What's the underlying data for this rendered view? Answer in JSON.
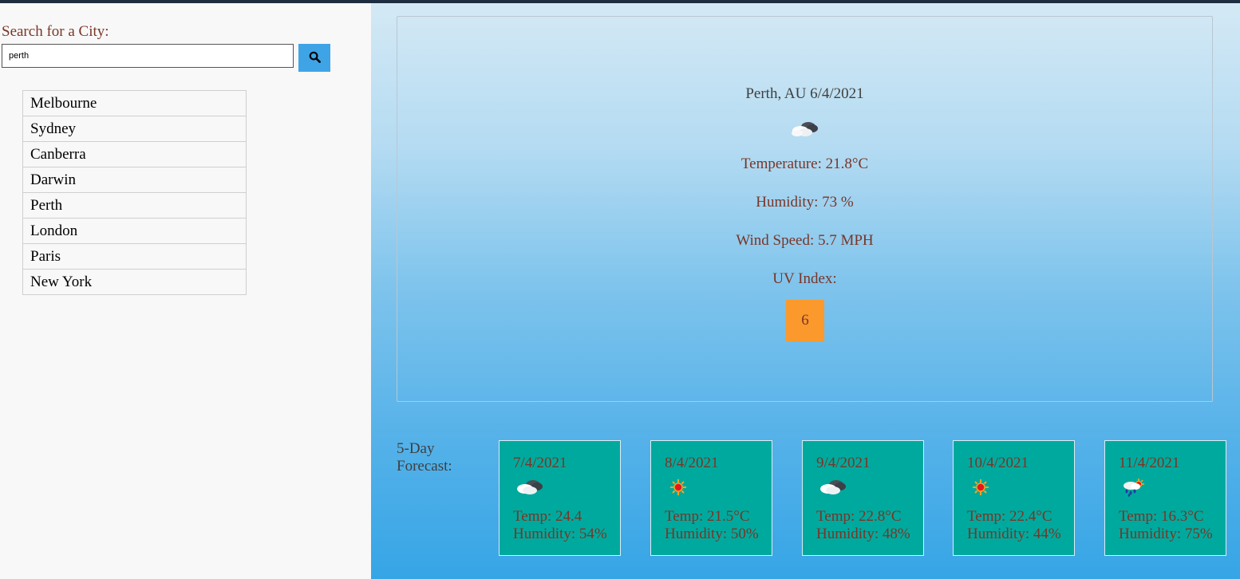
{
  "search": {
    "label": "Search for a City:",
    "value": "perth",
    "button_icon": "search-icon"
  },
  "history": [
    {
      "label": "Melbourne"
    },
    {
      "label": "Sydney"
    },
    {
      "label": "Canberra"
    },
    {
      "label": "Darwin"
    },
    {
      "label": "Perth"
    },
    {
      "label": "London"
    },
    {
      "label": "Paris"
    },
    {
      "label": "New York"
    }
  ],
  "current": {
    "heading": "Perth, AU 6/4/2021",
    "icon": "cloudy-icon",
    "temperature": "Temperature: 21.8°C",
    "humidity": "Humidity: 73 %",
    "wind": "Wind Speed: 5.7 MPH",
    "uv_label": "UV Index:",
    "uv_value": "6"
  },
  "forecast": {
    "title": "5-Day Forecast:",
    "days": [
      {
        "date": "7/4/2021",
        "icon": "cloudy-icon",
        "temp": "Temp: 24.4",
        "humidity": "Humidity: 54%"
      },
      {
        "date": "8/4/2021",
        "icon": "sun-icon",
        "temp": "Temp: 21.5°C",
        "humidity": "Humidity: 50%"
      },
      {
        "date": "9/4/2021",
        "icon": "cloudy-icon",
        "temp": "Temp: 22.8°C",
        "humidity": "Humidity: 48%"
      },
      {
        "date": "10/4/2021",
        "icon": "sun-icon",
        "temp": "Temp: 22.4°C",
        "humidity": "Humidity: 44%"
      },
      {
        "date": "11/4/2021",
        "icon": "rain-sun-icon",
        "temp": "Temp: 16.3°C",
        "humidity": "Humidity: 75%"
      }
    ]
  },
  "colors": {
    "uv_moderate": "#fb992d",
    "forecast_card": "#00a99d",
    "search_button": "#3fa4e6",
    "accent_text": "#7a3527"
  }
}
